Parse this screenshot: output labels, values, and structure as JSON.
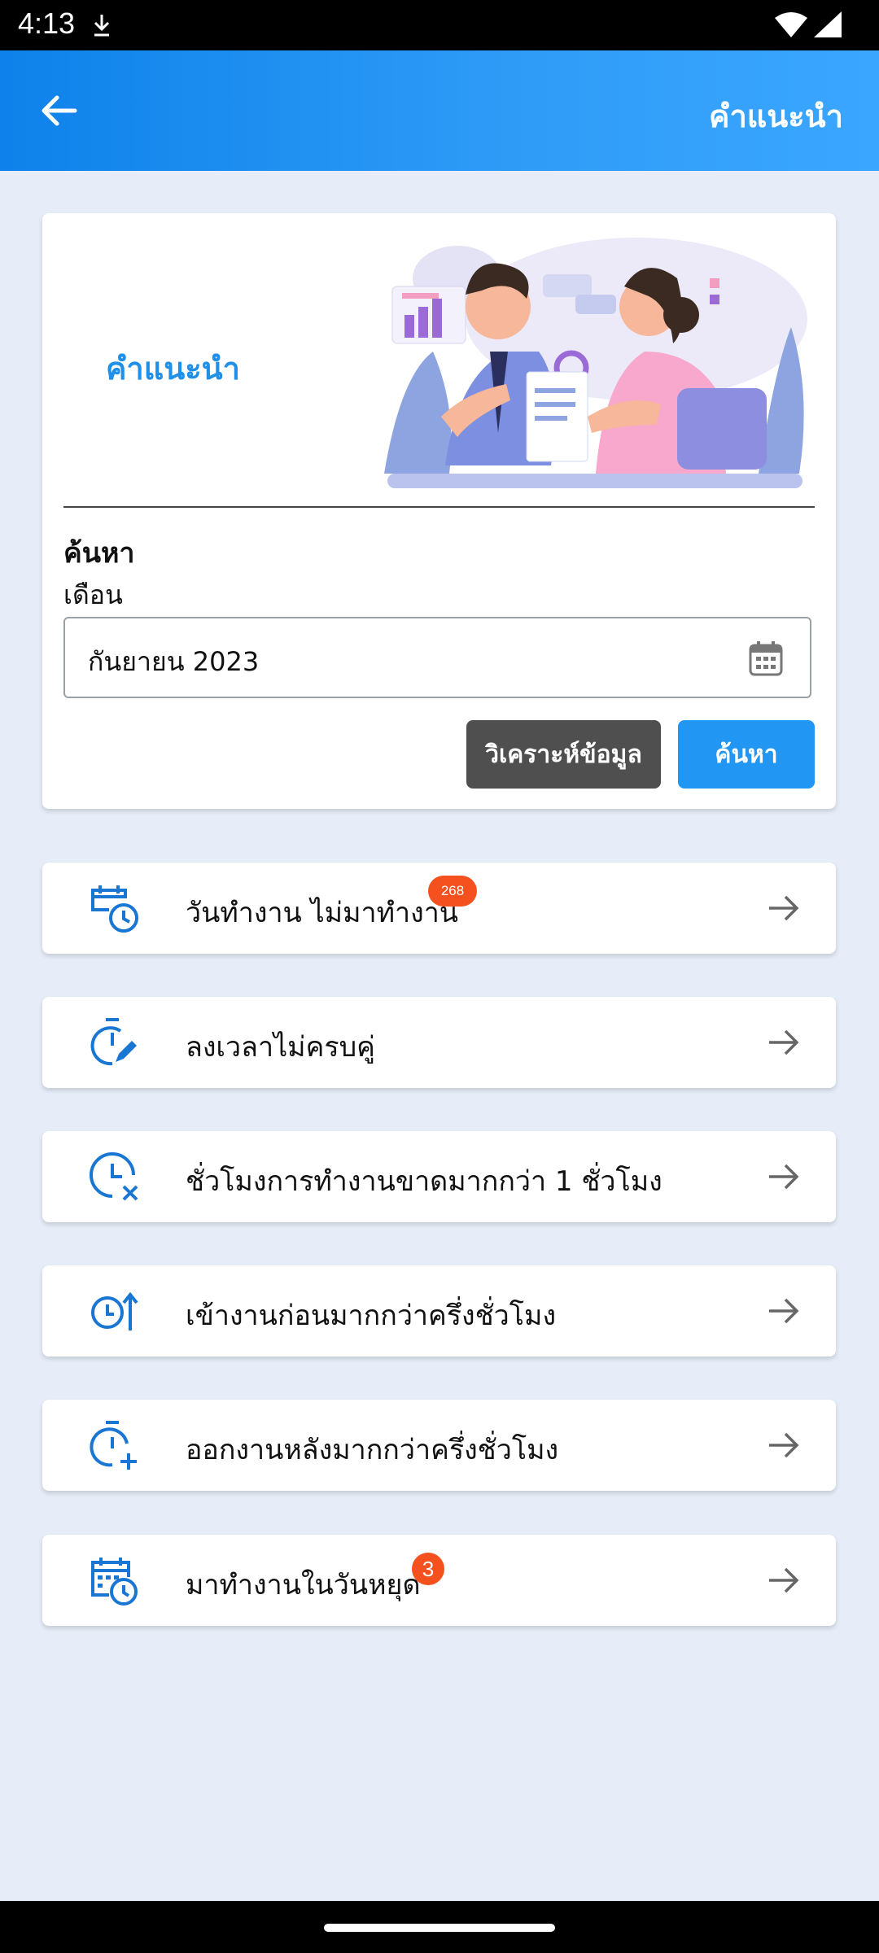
{
  "status_bar": {
    "time": "4:13"
  },
  "app_bar": {
    "title": "คำแนะนำ"
  },
  "hero": {
    "title": "คำแนะนำ"
  },
  "search": {
    "title": "ค้นหา",
    "month_label": "เดือน",
    "month_value": "กันยายน 2023",
    "analyze_button": "วิเคราะห์ข้อมูล",
    "search_button": "ค้นหา"
  },
  "menu": [
    {
      "label": "วันทำงาน ไม่มาทำงาน",
      "icon": "calendar-clock-icon",
      "badge": "268"
    },
    {
      "label": "ลงเวลาไม่ครบคู่",
      "icon": "timer-edit-icon"
    },
    {
      "label": "ชั่วโมงการทำงานขาดมากกว่า 1 ชั่วโมง",
      "icon": "clock-remove-icon"
    },
    {
      "label": "เข้างานก่อนมากกว่าครึ่งชั่วโมง",
      "icon": "clock-arrow-up-icon"
    },
    {
      "label": "ออกงานหลังมากกว่าครึ่งชั่วโมง",
      "icon": "timer-plus-icon"
    },
    {
      "label": "มาทำงานในวันหยุด",
      "icon": "calendar-clock-icon",
      "badge": "3"
    }
  ],
  "colors": {
    "accent": "#2196f3",
    "badge": "#f4511e",
    "dark_button": "#4f4f4f",
    "icon": "#1976d2"
  }
}
